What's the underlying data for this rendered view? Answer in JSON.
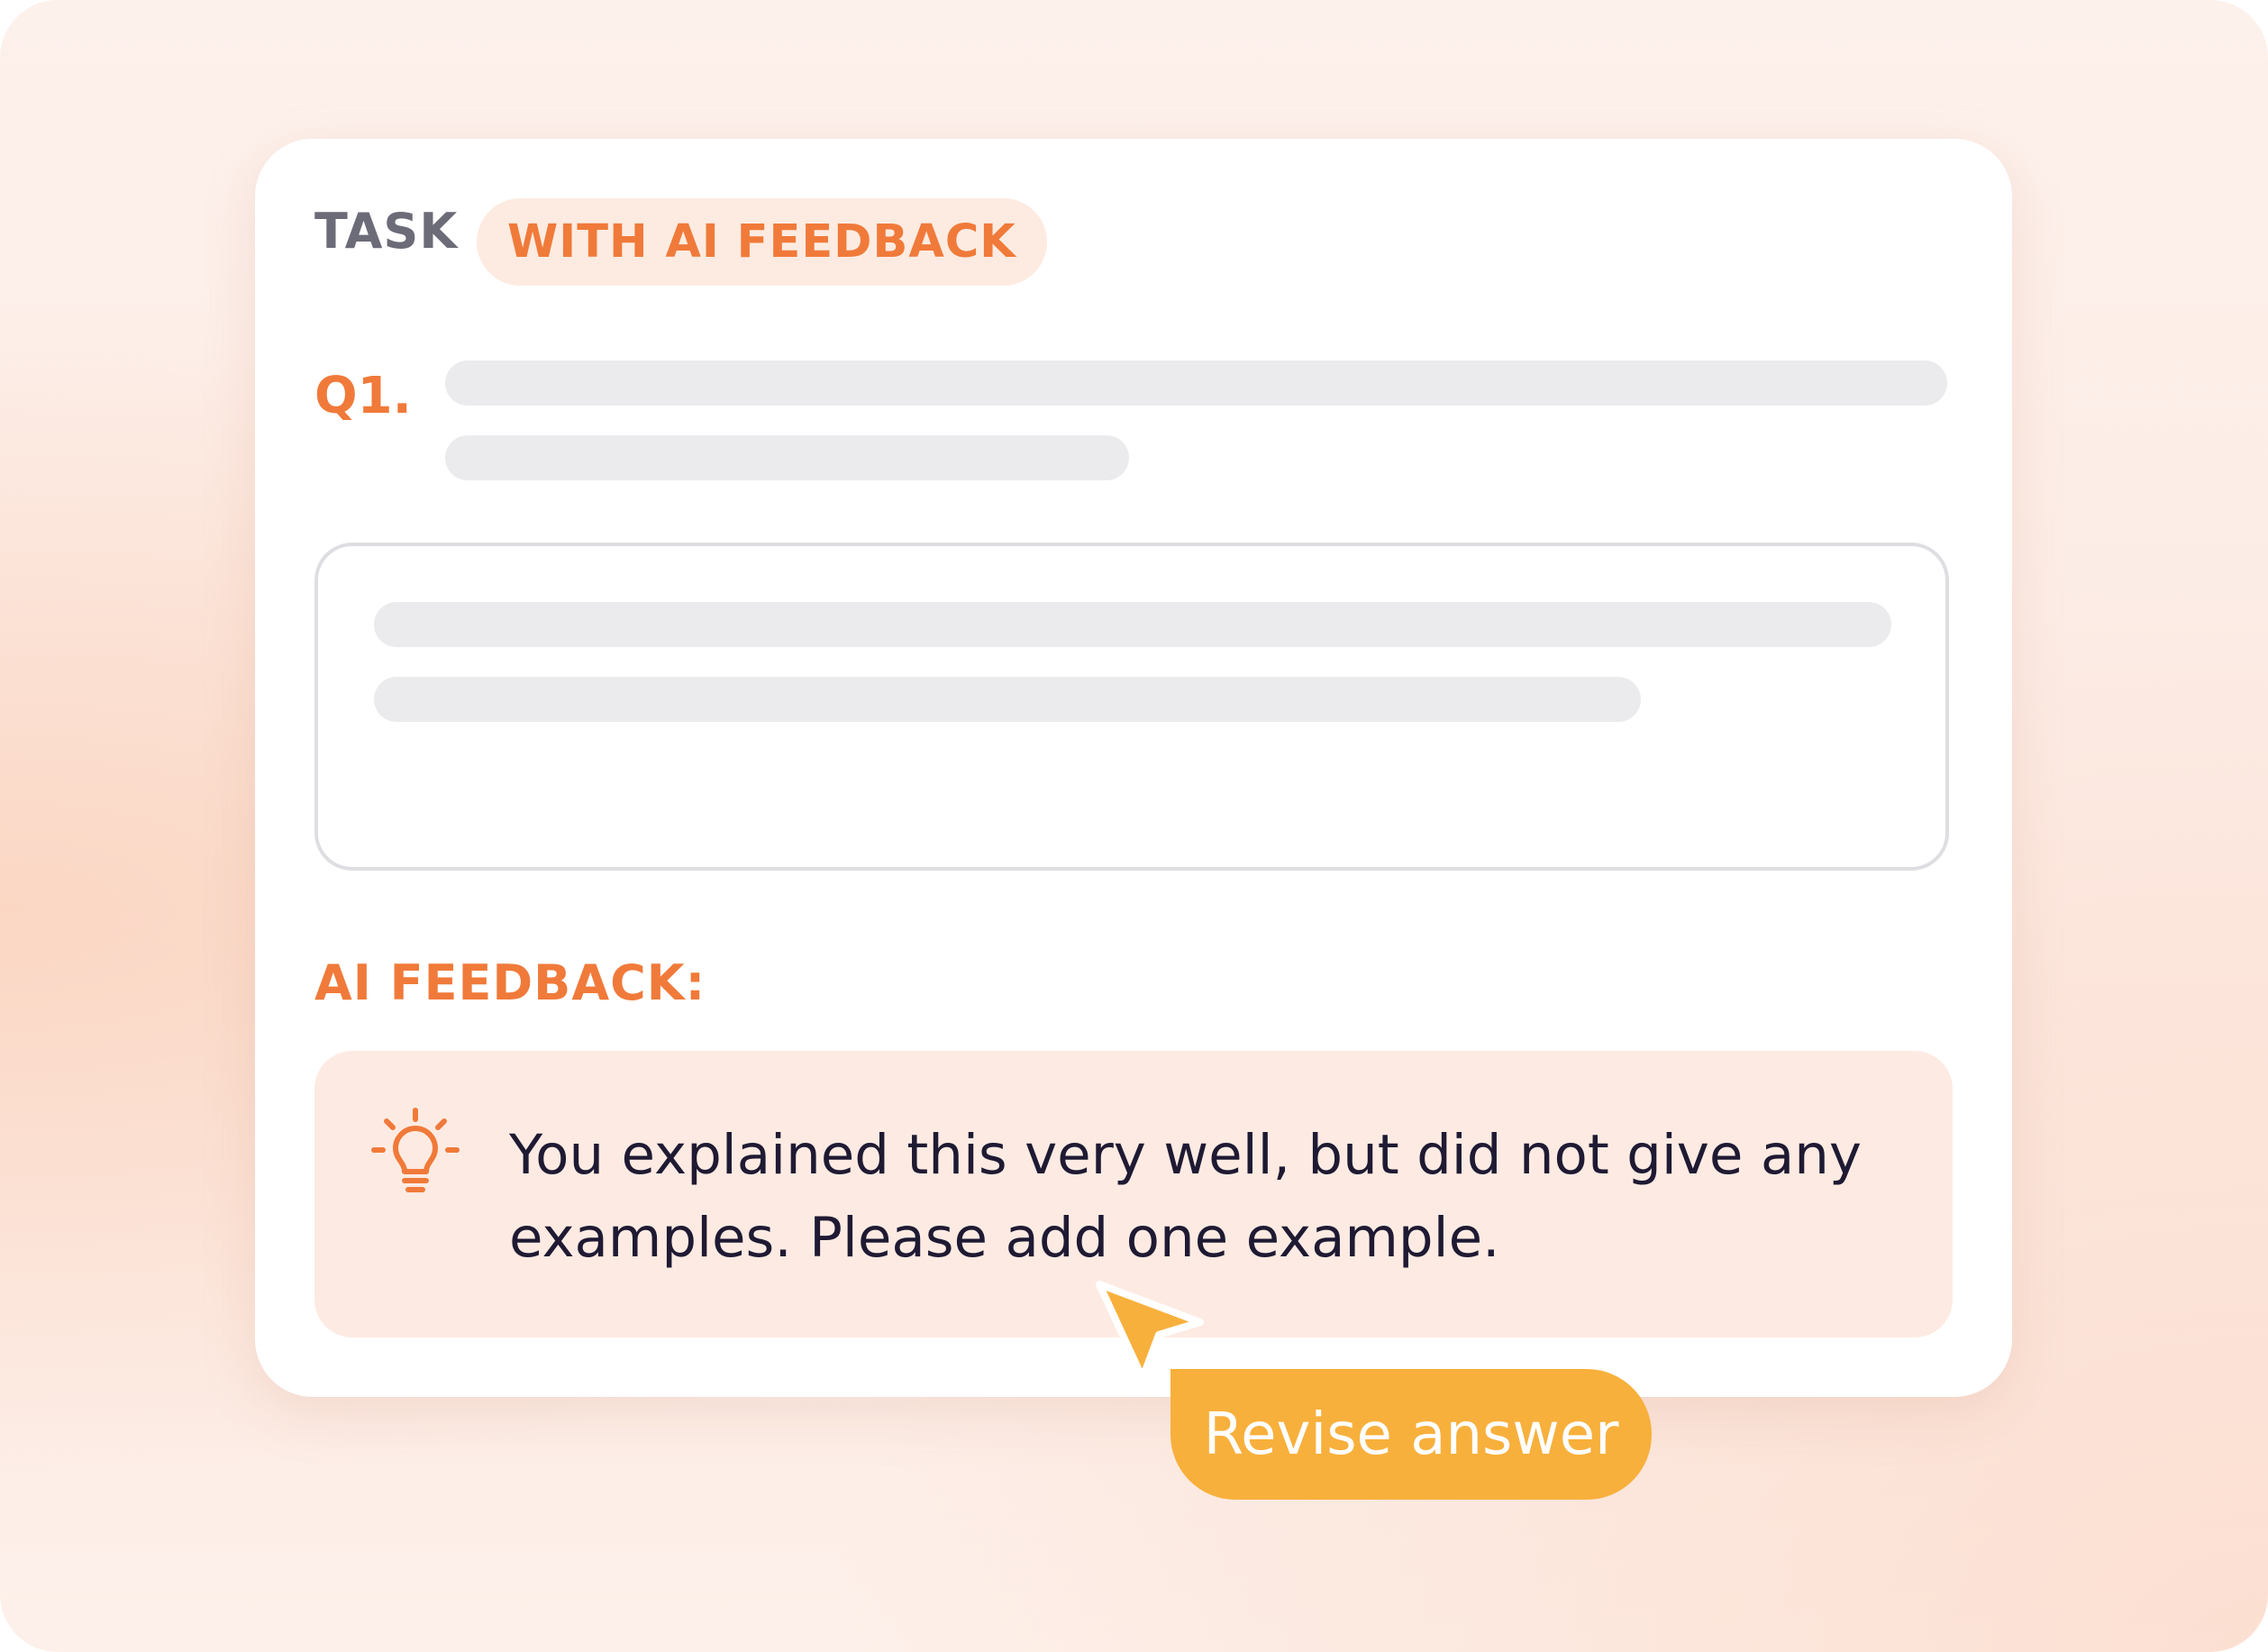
{
  "task": {
    "label": "TASK",
    "badge": "WITH AI FEEDBACK"
  },
  "question": {
    "number": "Q1."
  },
  "feedback": {
    "heading": "AI FEEDBACK:",
    "icon": "lightbulb-icon",
    "message": "You explained this very well, but did not give any examples. Please add one example."
  },
  "actions": {
    "revise_label": "Revise answer",
    "cursor_icon": "pointer-cursor-icon"
  },
  "colors": {
    "accent": "#f07a3a",
    "badge_bg": "#fdebe1",
    "feedback_bg": "#fdebe3",
    "button": "#f8b03c",
    "muted_text": "#6c6b78",
    "skeleton": "#ebebed"
  }
}
